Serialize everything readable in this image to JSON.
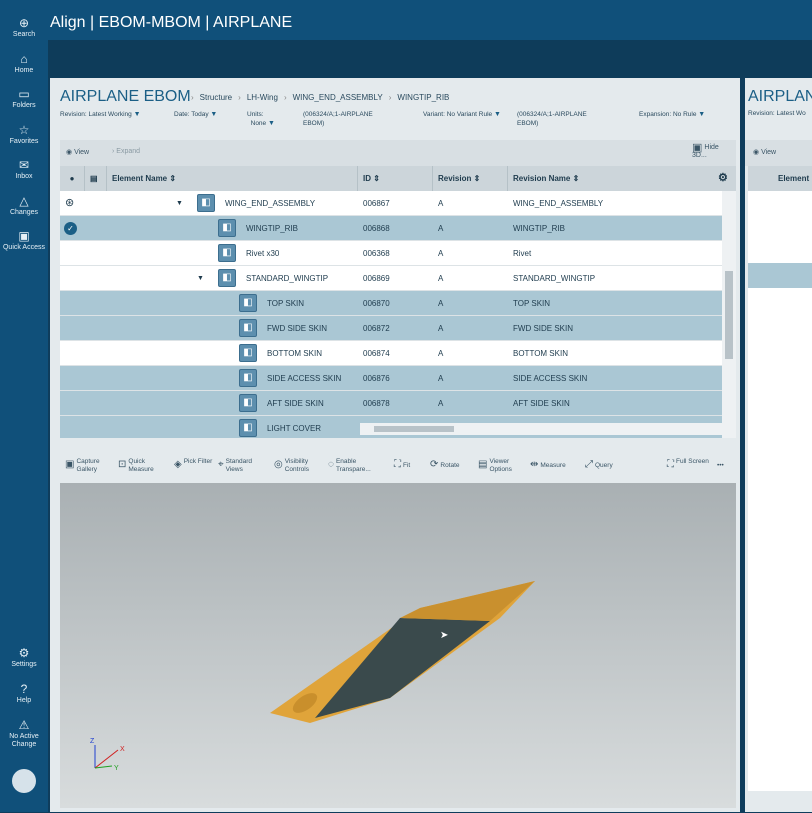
{
  "app": {
    "title": "Align | EBOM-MBOM | AIRPLANE"
  },
  "sidebar": {
    "items": [
      {
        "label": "Search",
        "icon": "search-icon",
        "g": "⊕"
      },
      {
        "label": "Home",
        "icon": "home-icon",
        "g": "⌂"
      },
      {
        "label": "Folders",
        "icon": "folder-icon",
        "g": "▭"
      },
      {
        "label": "Favorites",
        "icon": "star-icon",
        "g": "☆"
      },
      {
        "label": "Inbox",
        "icon": "inbox-icon",
        "g": "✉"
      },
      {
        "label": "Changes",
        "icon": "changes-icon",
        "g": "△"
      },
      {
        "label": "Quick Access",
        "icon": "quick-access-icon",
        "g": "▣"
      }
    ],
    "bottom": [
      {
        "label": "Settings",
        "icon": "gear-icon",
        "g": "⚙"
      },
      {
        "label": "Help",
        "icon": "help-icon",
        "g": "?"
      },
      {
        "label": "No Active Change",
        "icon": "change-icon",
        "g": "⚠"
      }
    ]
  },
  "panel": {
    "title": "AIRPLANE EBOM",
    "breadcrumb": [
      "Structure",
      "LH-Wing",
      "WING_END_ASSEMBLY",
      "WINGTIP_RIB"
    ],
    "filters": {
      "revision_label": "Revision:",
      "revision": "Latest Working",
      "date_label": "Date:",
      "date": "Today",
      "units_label": "Units:",
      "units": "None",
      "context1": "(006324/A;1-AIRPLANE EBOM)",
      "variant_label": "Variant:",
      "variant": "No Variant Rule",
      "context2": "(006324/A;1-AIRPLANE EBOM)",
      "expansion_label": "Expansion:",
      "expansion": "No Rule"
    },
    "toolbar": {
      "view": "View",
      "expand": "Expand",
      "hide3d": "Hide 3D..."
    },
    "columns": [
      "Element Name",
      "ID",
      "Revision",
      "Revision Name"
    ],
    "rows": [
      {
        "name": "WING_END_ASSEMBLY",
        "id": "006867",
        "rev": "A",
        "revname": "WING_END_ASSEMBLY",
        "level": 0,
        "caret": true,
        "hl": false
      },
      {
        "name": "WINGTIP_RIB",
        "id": "006868",
        "rev": "A",
        "revname": "WINGTIP_RIB",
        "level": 1,
        "caret": false,
        "hl": true,
        "checked": true
      },
      {
        "name": "Rivet x30",
        "id": "006368",
        "rev": "A",
        "revname": "Rivet",
        "level": 1,
        "caret": false,
        "hl": false
      },
      {
        "name": "STANDARD_WINGTIP",
        "id": "006869",
        "rev": "A",
        "revname": "STANDARD_WINGTIP",
        "level": 1,
        "caret": true,
        "hl": false
      },
      {
        "name": "TOP SKIN",
        "id": "006870",
        "rev": "A",
        "revname": "TOP SKIN",
        "level": 2,
        "hl": true
      },
      {
        "name": "FWD SIDE SKIN",
        "id": "006872",
        "rev": "A",
        "revname": "FWD SIDE SKIN",
        "level": 2,
        "hl": true
      },
      {
        "name": "BOTTOM SKIN",
        "id": "006874",
        "rev": "A",
        "revname": "BOTTOM SKIN",
        "level": 2,
        "hl": false
      },
      {
        "name": "SIDE ACCESS SKIN",
        "id": "006876",
        "rev": "A",
        "revname": "SIDE ACCESS SKIN",
        "level": 2,
        "hl": true
      },
      {
        "name": "AFT SIDE SKIN",
        "id": "006878",
        "rev": "A",
        "revname": "AFT SIDE SKIN",
        "level": 2,
        "hl": true
      },
      {
        "name": "LIGHT COVER",
        "id": "",
        "rev": "",
        "revname": "",
        "level": 2,
        "hl": true
      }
    ],
    "viewer_toolbar": [
      "Capture Gallery",
      "Quick Measure",
      "Pick Filter",
      "Standard Views",
      "Visibility Controls",
      "Enable Transpare...",
      "Fit",
      "Rotate",
      "Viewer Options",
      "Measure",
      "Query",
      "Full Screen",
      "•••"
    ]
  },
  "right_panel": {
    "title": "AIRPLANE",
    "revision": "Revision: Latest Wo",
    "view": "View",
    "col": "Element"
  },
  "colors": {
    "sidebar": "#10507a",
    "highlight": "#aac7d4",
    "title": "#1b5f86",
    "part_orange": "#e0a43a",
    "part_dark": "#3a4a4c"
  }
}
